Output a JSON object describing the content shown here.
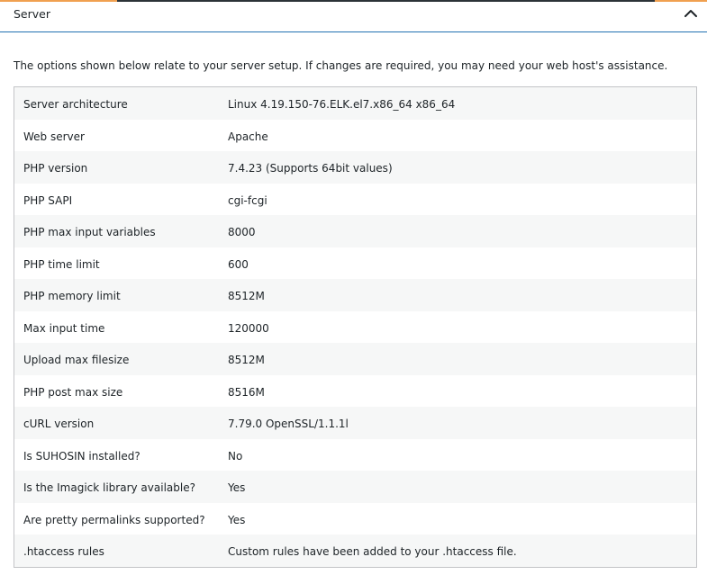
{
  "section": {
    "title": "Server",
    "collapse_icon": "chevron-up-icon",
    "description": "The options shown below relate to your server setup. If changes are required, you may need your web host's assistance."
  },
  "colors": {
    "accent": "#f0a050",
    "header_border": "#2271b1",
    "row_alt": "#f6f7f7",
    "table_border": "#c3c4c7"
  },
  "rows": [
    {
      "label": "Server architecture",
      "value": "Linux 4.19.150-76.ELK.el7.x86_64 x86_64"
    },
    {
      "label": "Web server",
      "value": "Apache"
    },
    {
      "label": "PHP version",
      "value": "7.4.23 (Supports 64bit values)"
    },
    {
      "label": "PHP SAPI",
      "value": "cgi-fcgi"
    },
    {
      "label": "PHP max input variables",
      "value": "8000"
    },
    {
      "label": "PHP time limit",
      "value": "600"
    },
    {
      "label": "PHP memory limit",
      "value": "8512M"
    },
    {
      "label": "Max input time",
      "value": "120000"
    },
    {
      "label": "Upload max filesize",
      "value": "8512M"
    },
    {
      "label": "PHP post max size",
      "value": "8516M"
    },
    {
      "label": "cURL version",
      "value": "7.79.0 OpenSSL/1.1.1l"
    },
    {
      "label": "Is SUHOSIN installed?",
      "value": "No"
    },
    {
      "label": "Is the Imagick library available?",
      "value": "Yes"
    },
    {
      "label": "Are pretty permalinks supported?",
      "value": "Yes"
    },
    {
      "label": ".htaccess rules",
      "value": "Custom rules have been added to your .htaccess file."
    }
  ]
}
